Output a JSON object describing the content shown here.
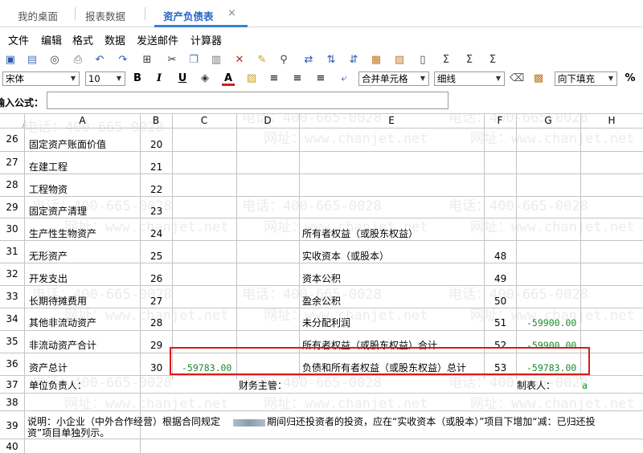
{
  "tabs": [
    {
      "label": "我的桌面"
    },
    {
      "label": "报表数据"
    },
    {
      "label": "资产负债表",
      "active": true
    }
  ],
  "tab_close_glyph": "×",
  "menu": [
    "文件",
    "编辑",
    "格式",
    "数据",
    "发送邮件",
    "计算器"
  ],
  "toolbar": {
    "font_name": "宋体",
    "font_size": "10",
    "bold": "B",
    "italic": "I",
    "underline": "U",
    "font_color": "A",
    "merge": "合并单元格",
    "border": "细线",
    "fill": "向下填充",
    "percent": "%",
    "sum": "Σ"
  },
  "formula_label": "输入公式：",
  "formula_value": "",
  "columns": [
    "A",
    "B",
    "C",
    "D",
    "E",
    "F",
    "G",
    "H"
  ],
  "rows": [
    {
      "num": "26",
      "a": "固定资产账面价值",
      "b": "20"
    },
    {
      "num": "27",
      "a": "在建工程",
      "b": "21"
    },
    {
      "num": "28",
      "a": "工程物资",
      "b": "22"
    },
    {
      "num": "29",
      "a": "固定资产清理",
      "b": "23"
    },
    {
      "num": "30",
      "a": "生产性生物资产",
      "b": "24",
      "e": "所有者权益（或股东权益）"
    },
    {
      "num": "31",
      "a": "无形资产",
      "b": "25",
      "e": "实收资本（或股本）",
      "f": "48"
    },
    {
      "num": "32",
      "a": "开发支出",
      "b": "26",
      "e": "资本公积",
      "f": "49"
    },
    {
      "num": "33",
      "a": "长期待摊费用",
      "b": "27",
      "e": "盈余公积",
      "f": "50"
    },
    {
      "num": "34",
      "a": "其他非流动资产",
      "b": "28",
      "e": "未分配利润",
      "f": "51",
      "g": "-59900.00"
    },
    {
      "num": "35",
      "a": "非流动资产合计",
      "b": "29",
      "e": "所有者权益（或股东权益）合计",
      "f": "52",
      "g": "-59900.00"
    },
    {
      "num": "36",
      "a": "资产总计",
      "b": "30",
      "c": "-59783.00",
      "e": "负债和所有者权益（或股东权益）总计",
      "f": "53",
      "g": "-59783.00"
    },
    {
      "num": "37",
      "a": "单位负责人：",
      "d": "财务主管：",
      "g": "制表人：",
      "h": "a"
    },
    {
      "num": "38"
    },
    {
      "num": "39",
      "a": "说明：小企业（中外合作经营）根据合同规定",
      "note_tail": "期间归还投资者的投资，应在“实收资本（或股本）”项目下增加“减：已归还投",
      "note_line2": "资”项目单独列示。"
    },
    {
      "num": "40"
    }
  ],
  "watermarks": {
    "phone": "电话：400-665-0028",
    "site": "网址：www.chanjet.net"
  },
  "colors": {
    "accent": "#2766c4",
    "highlight": "#d91a1a",
    "number": "#1a8a2a"
  }
}
